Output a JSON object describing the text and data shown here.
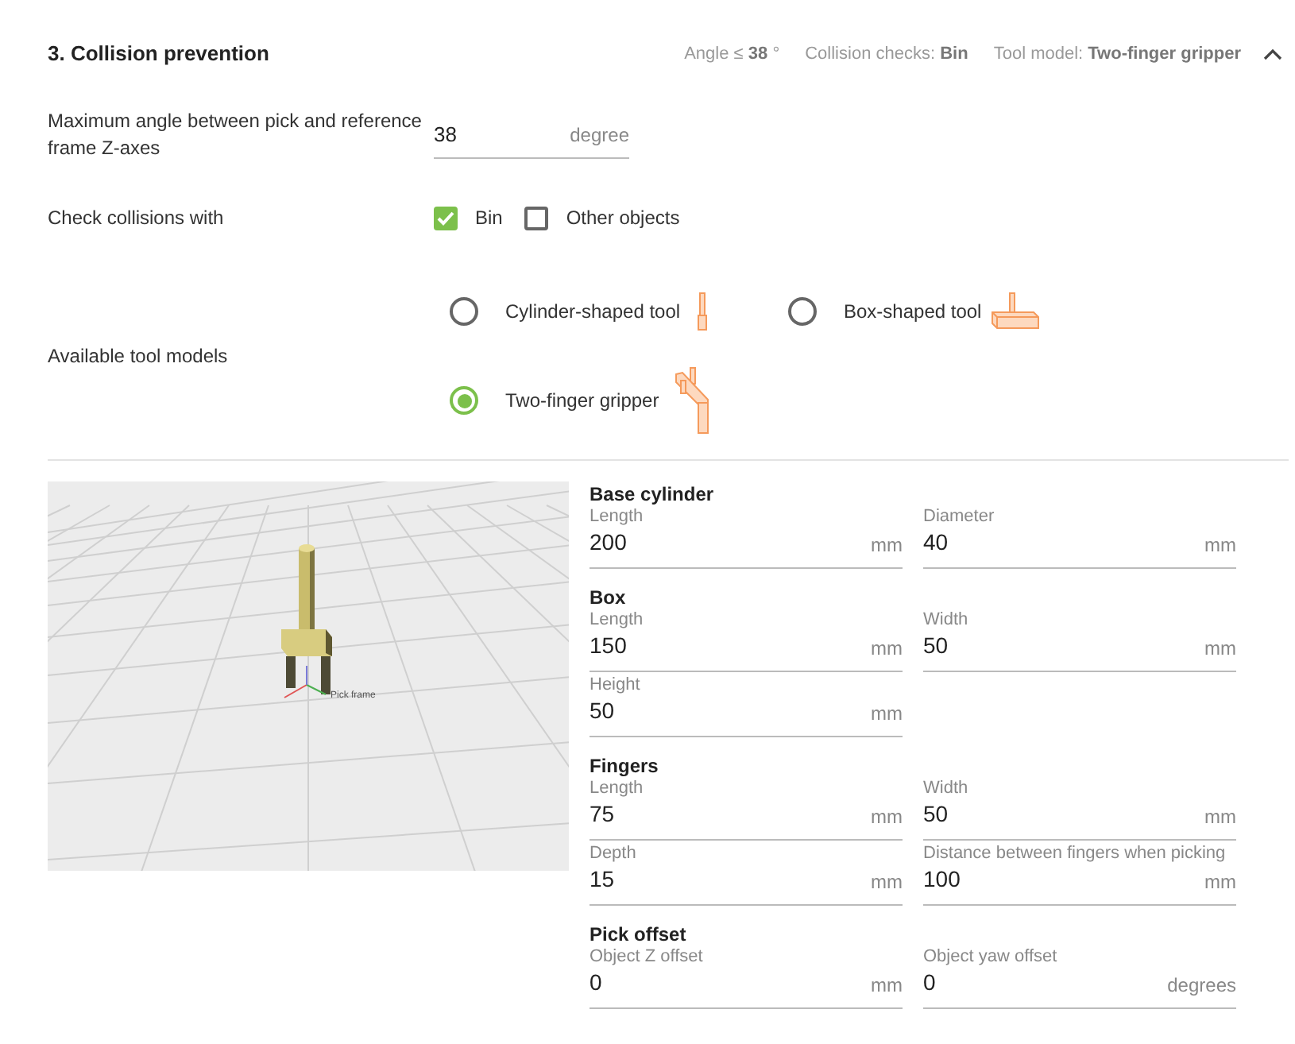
{
  "section": {
    "title": "3. Collision prevention",
    "expanded": true,
    "summary": [
      "Angle ≤ **38** °",
      "Collision checks: **Bin**",
      "Tool model: **Two-finger gripper**"
    ]
  },
  "angle": {
    "label": "Maximum angle between pick and reference frame Z-axes",
    "value": "38",
    "unit": "degree"
  },
  "checks": {
    "label": "Check collisions with",
    "options": [
      {
        "label": "Bin",
        "checked": true
      },
      {
        "label": "Other objects",
        "checked": false
      }
    ]
  },
  "tools": {
    "label": "Available tool models",
    "options": [
      {
        "label": "Cylinder-shaped tool",
        "kind": "cylinder",
        "selected": false
      },
      {
        "label": "Box-shaped tool",
        "kind": "box",
        "selected": false
      },
      {
        "label": "Two-finger gripper",
        "kind": "gripper",
        "selected": true
      }
    ]
  },
  "viewport": {
    "frame_label": "Pick frame"
  },
  "groups": [
    {
      "title": "Base cylinder",
      "fields": [
        {
          "label": "Length",
          "value": "200",
          "unit": "mm"
        },
        {
          "label": "Diameter",
          "value": "40",
          "unit": "mm"
        }
      ]
    },
    {
      "title": "Box",
      "fields": [
        {
          "label": "Length",
          "value": "150",
          "unit": "mm"
        },
        {
          "label": "Width",
          "value": "50",
          "unit": "mm"
        },
        {
          "label": "Height",
          "value": "50",
          "unit": "mm"
        }
      ]
    },
    {
      "title": "Fingers",
      "fields": [
        {
          "label": "Length",
          "value": "75",
          "unit": "mm"
        },
        {
          "label": "Width",
          "value": "50",
          "unit": "mm"
        },
        {
          "label": "Depth",
          "value": "15",
          "unit": "mm"
        },
        {
          "label": "Distance between fingers when picking",
          "value": "100",
          "unit": "mm"
        }
      ]
    },
    {
      "title": "Pick offset",
      "fields": [
        {
          "label": "Object Z offset",
          "value": "0",
          "unit": "mm"
        },
        {
          "label": "Object yaw offset",
          "value": "0",
          "unit": "degrees"
        }
      ]
    }
  ]
}
